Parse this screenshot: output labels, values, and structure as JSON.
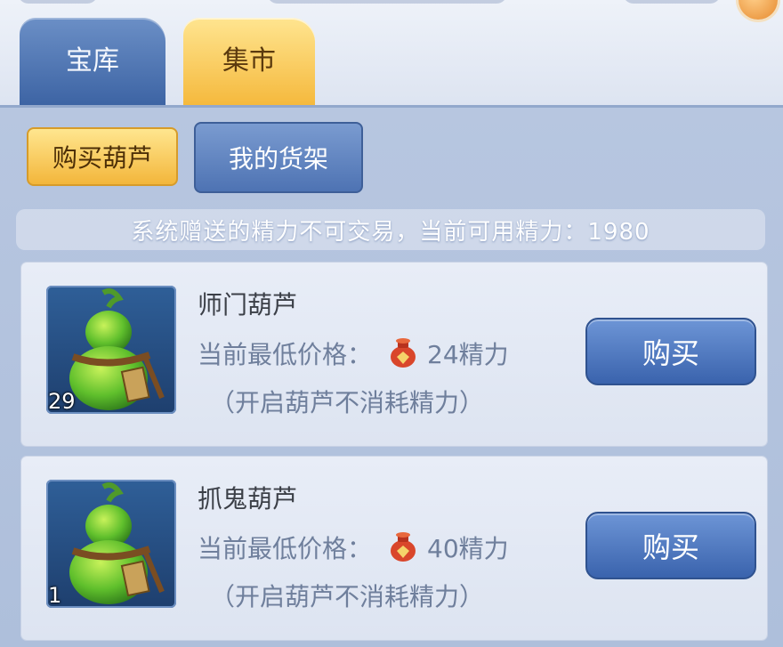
{
  "tabs": [
    {
      "label": "宝库"
    },
    {
      "label": "集市"
    }
  ],
  "subtabs": [
    {
      "label": "购买葫芦"
    },
    {
      "label": "我的货架"
    }
  ],
  "notice": "系统赠送的精力不可交易，当前可用精力：1980",
  "items": [
    {
      "name": "师门葫芦",
      "count": "29",
      "price_label": "当前最低价格：",
      "price": "24精力",
      "note": "（开启葫芦不消耗精力）",
      "buy_label": "购买",
      "icon": "green-gourd-icon"
    },
    {
      "name": "抓鬼葫芦",
      "count": "1",
      "price_label": "当前最低价格：",
      "price": "40精力",
      "note": "（开启葫芦不消耗精力）",
      "buy_label": "购买",
      "icon": "green-gourd-icon"
    }
  ],
  "colors": {
    "active_tab": "#f5b93d",
    "inactive_tab": "#3d64a4",
    "panel": "#b7c6e0"
  }
}
